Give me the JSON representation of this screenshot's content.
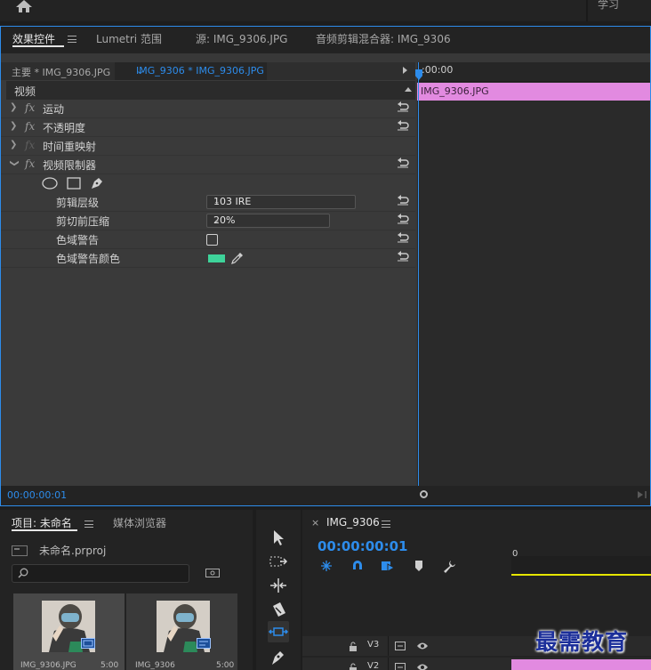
{
  "topbar": {
    "workspace_label": "学习"
  },
  "effect_controls": {
    "tabs": [
      {
        "label": "效果控件"
      },
      {
        "label": "Lumetri 范围"
      },
      {
        "label": "源: IMG_9306.JPG"
      },
      {
        "label": "音频剪辑混合器: IMG_9306"
      }
    ],
    "master_label": "主要 * IMG_9306.JPG",
    "clip_label": "IMG_9306 * IMG_9306.JPG",
    "section_label": "视频",
    "effects": [
      {
        "fx": "fx",
        "name": "运动"
      },
      {
        "fx": "fx",
        "name": "不透明度"
      },
      {
        "fx": "fx",
        "name": "时间重映射"
      },
      {
        "fx": "fx",
        "name": "视频限制器"
      }
    ],
    "params": {
      "clip_level": {
        "label": "剪辑层级",
        "value": "103 IRE"
      },
      "clip_compression": {
        "label": "剪切前压缩",
        "value": "20%"
      },
      "gamut_warning": {
        "label": "色域警告"
      },
      "gamut_warning_color": {
        "label": "色域警告颜色",
        "color": "#3ed39a"
      }
    },
    "timeline_ruler": ":00:00",
    "clip_bar_label": "IMG_9306.JPG",
    "clip_color": "#e28ae0",
    "timecode": "00:00:00:01"
  },
  "project": {
    "tab_project": "项目: 未命名",
    "tab_media": "媒体浏览器",
    "file_name": "未命名.prproj",
    "search_placeholder": "",
    "items": [
      {
        "name": "IMG_9306.JPG",
        "duration": "5:00"
      },
      {
        "name": "IMG_9306",
        "duration": "5:00"
      }
    ]
  },
  "timeline": {
    "tab_label": "IMG_9306",
    "timecode": "00:00:00:01",
    "ruler_zero": "0",
    "tracks": [
      {
        "label": "V3"
      },
      {
        "label": "V2"
      }
    ],
    "accent": "#2d8ceb"
  },
  "watermark": "最需教育"
}
